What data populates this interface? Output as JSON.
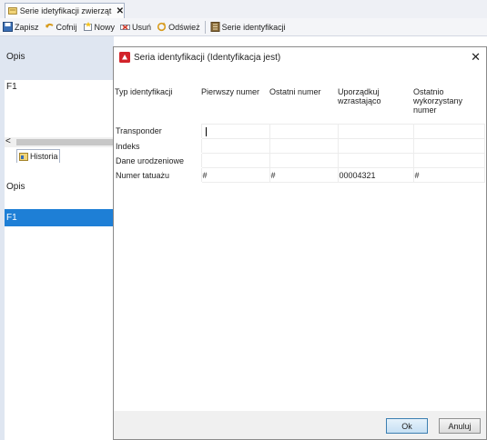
{
  "tab": {
    "label": "Serie idetyfikacji zwierząt",
    "close": "✕"
  },
  "toolbar": {
    "save": "Zapisz",
    "undo": "Cofnij",
    "new": "Nowy",
    "delete": "Usuń",
    "refresh": "Odśwież",
    "series": "Serie identyfikacji"
  },
  "left": {
    "opis_label": "Opis",
    "row_value": "F1",
    "scroll_left": "<",
    "history_tab": "Historia",
    "opis_label_2": "Opis",
    "selected_row": "F1"
  },
  "dialog": {
    "title": "Seria identyfikacji  (Identyfikacja jest)",
    "close": "✕",
    "columns": [
      "Typ identyfikacji",
      "Pierwszy numer",
      "Ostatni numer",
      "Uporządkuj wzrastająco",
      "Ostatnio wykorzystany numer"
    ],
    "rows": [
      {
        "type": "Transponder",
        "first": "",
        "last": "",
        "asc": "",
        "lastused": ""
      },
      {
        "type": "Indeks",
        "first": "",
        "last": "",
        "asc": "",
        "lastused": ""
      },
      {
        "type": "Dane urodzeniowe",
        "first": "",
        "last": "",
        "asc": "",
        "lastused": ""
      },
      {
        "type": "Numer tatuażu",
        "first": "#",
        "last": "#",
        "asc": "00004321",
        "lastused": "#"
      }
    ],
    "ok": "Ok",
    "cancel": "Anuluj"
  }
}
